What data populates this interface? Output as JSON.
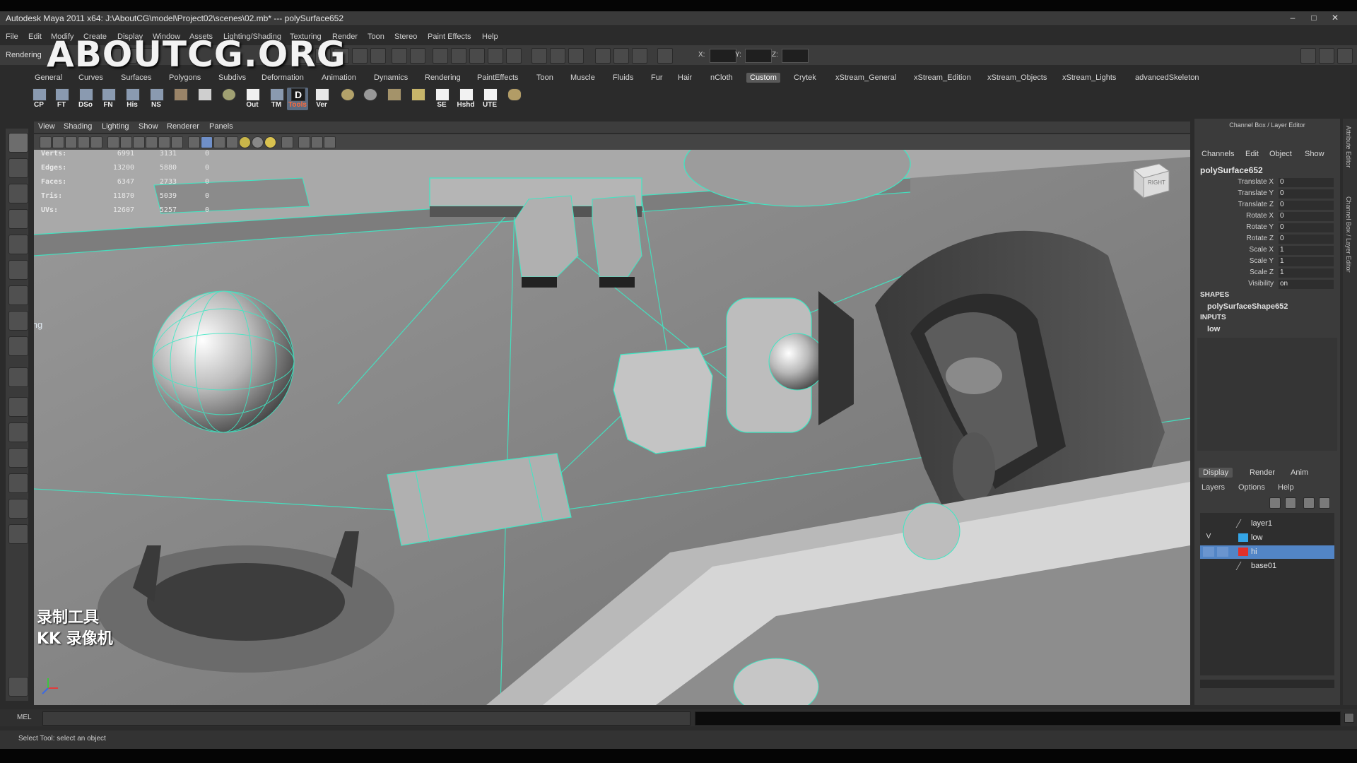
{
  "window": {
    "title": "Autodesk Maya 2011 x64: J:\\AboutCG\\model\\Project02\\scenes\\02.mb*  ---  polySurface652"
  },
  "menubar": [
    "File",
    "Edit",
    "Modify",
    "Create",
    "Display",
    "Window",
    "Assets",
    "Lighting/Shading",
    "Texturing",
    "Render",
    "Toon",
    "Stereo",
    "Paint Effects",
    "Help"
  ],
  "statusline": {
    "mode": "Rendering",
    "x_label": "X:",
    "y_label": "Y:",
    "z_label": "Z:"
  },
  "watermark": "ABOUTCG.ORG",
  "shelf": {
    "tabs": [
      "General",
      "Curves",
      "Surfaces",
      "Polygons",
      "Subdivs",
      "Deformation",
      "Animation",
      "Dynamics",
      "Rendering",
      "PaintEffects",
      "Toon",
      "Muscle",
      "Fluids",
      "Fur",
      "Hair",
      "nCloth",
      "Custom",
      "Crytek",
      "xStream_General",
      "xStream_Edition",
      "xStream_Objects",
      "xStream_Lights",
      "advancedSkeleton"
    ],
    "active_tab": "Custom",
    "icons": [
      "CP",
      "FT",
      "DSo",
      "FN",
      "His",
      "NS",
      "",
      "",
      "",
      "Out",
      "TM",
      "Tools",
      "Ver",
      "",
      "",
      "",
      "",
      "SE",
      "Hshd",
      "UTE",
      ""
    ]
  },
  "viewport": {
    "menu": [
      "View",
      "Shading",
      "Lighting",
      "Show",
      "Renderer",
      "Panels"
    ],
    "hud": [
      {
        "label": "Verts:",
        "a": "6991",
        "b": "3131",
        "c": "0"
      },
      {
        "label": "Edges:",
        "a": "13200",
        "b": "5880",
        "c": "0"
      },
      {
        "label": "Faces:",
        "a": "6347",
        "b": "2733",
        "c": "0"
      },
      {
        "label": "Tris:",
        "a": "11870",
        "b": "5039",
        "c": "0"
      },
      {
        "label": "UVs:",
        "a": "12607",
        "b": "5257",
        "c": "0"
      }
    ],
    "side_label": "marking",
    "overlay_line1": "录制工具",
    "overlay_line2": "KK 录像机",
    "viewcube_label": "RIGHT"
  },
  "channel_box": {
    "title": "Channel Box / Layer Editor",
    "menus": [
      "Channels",
      "Edit",
      "Object",
      "Show"
    ],
    "object": "polySurface652",
    "attributes": [
      {
        "name": "Translate X",
        "value": "0"
      },
      {
        "name": "Translate Y",
        "value": "0"
      },
      {
        "name": "Translate Z",
        "value": "0"
      },
      {
        "name": "Rotate X",
        "value": "0"
      },
      {
        "name": "Rotate Y",
        "value": "0"
      },
      {
        "name": "Rotate Z",
        "value": "0"
      },
      {
        "name": "Scale X",
        "value": "1"
      },
      {
        "name": "Scale Y",
        "value": "1"
      },
      {
        "name": "Scale Z",
        "value": "1"
      },
      {
        "name": "Visibility",
        "value": "on"
      }
    ],
    "shapes_header": "SHAPES",
    "shape": "polySurfaceShape652",
    "inputs_header": "INPUTS",
    "input": "low"
  },
  "layer_editor": {
    "tabs": [
      "Display",
      "Render",
      "Anim"
    ],
    "active_tab": "Display",
    "menus": [
      "Layers",
      "Options",
      "Help"
    ],
    "layers": [
      {
        "name": "layer1",
        "visible": "",
        "color": ""
      },
      {
        "name": "low",
        "visible": "V",
        "color": "#34a5e6"
      },
      {
        "name": "hi",
        "visible": "",
        "color": "#e2312b"
      },
      {
        "name": "base01",
        "visible": "",
        "color": ""
      }
    ]
  },
  "side_strip": [
    "Attribute Editor",
    "Channel Box / Layer Editor"
  ],
  "command_line": {
    "label": "MEL"
  },
  "help_line": "Select Tool: select an object",
  "colors": {
    "wireframe": "#3ee8c4",
    "selection": "#5285c6"
  }
}
